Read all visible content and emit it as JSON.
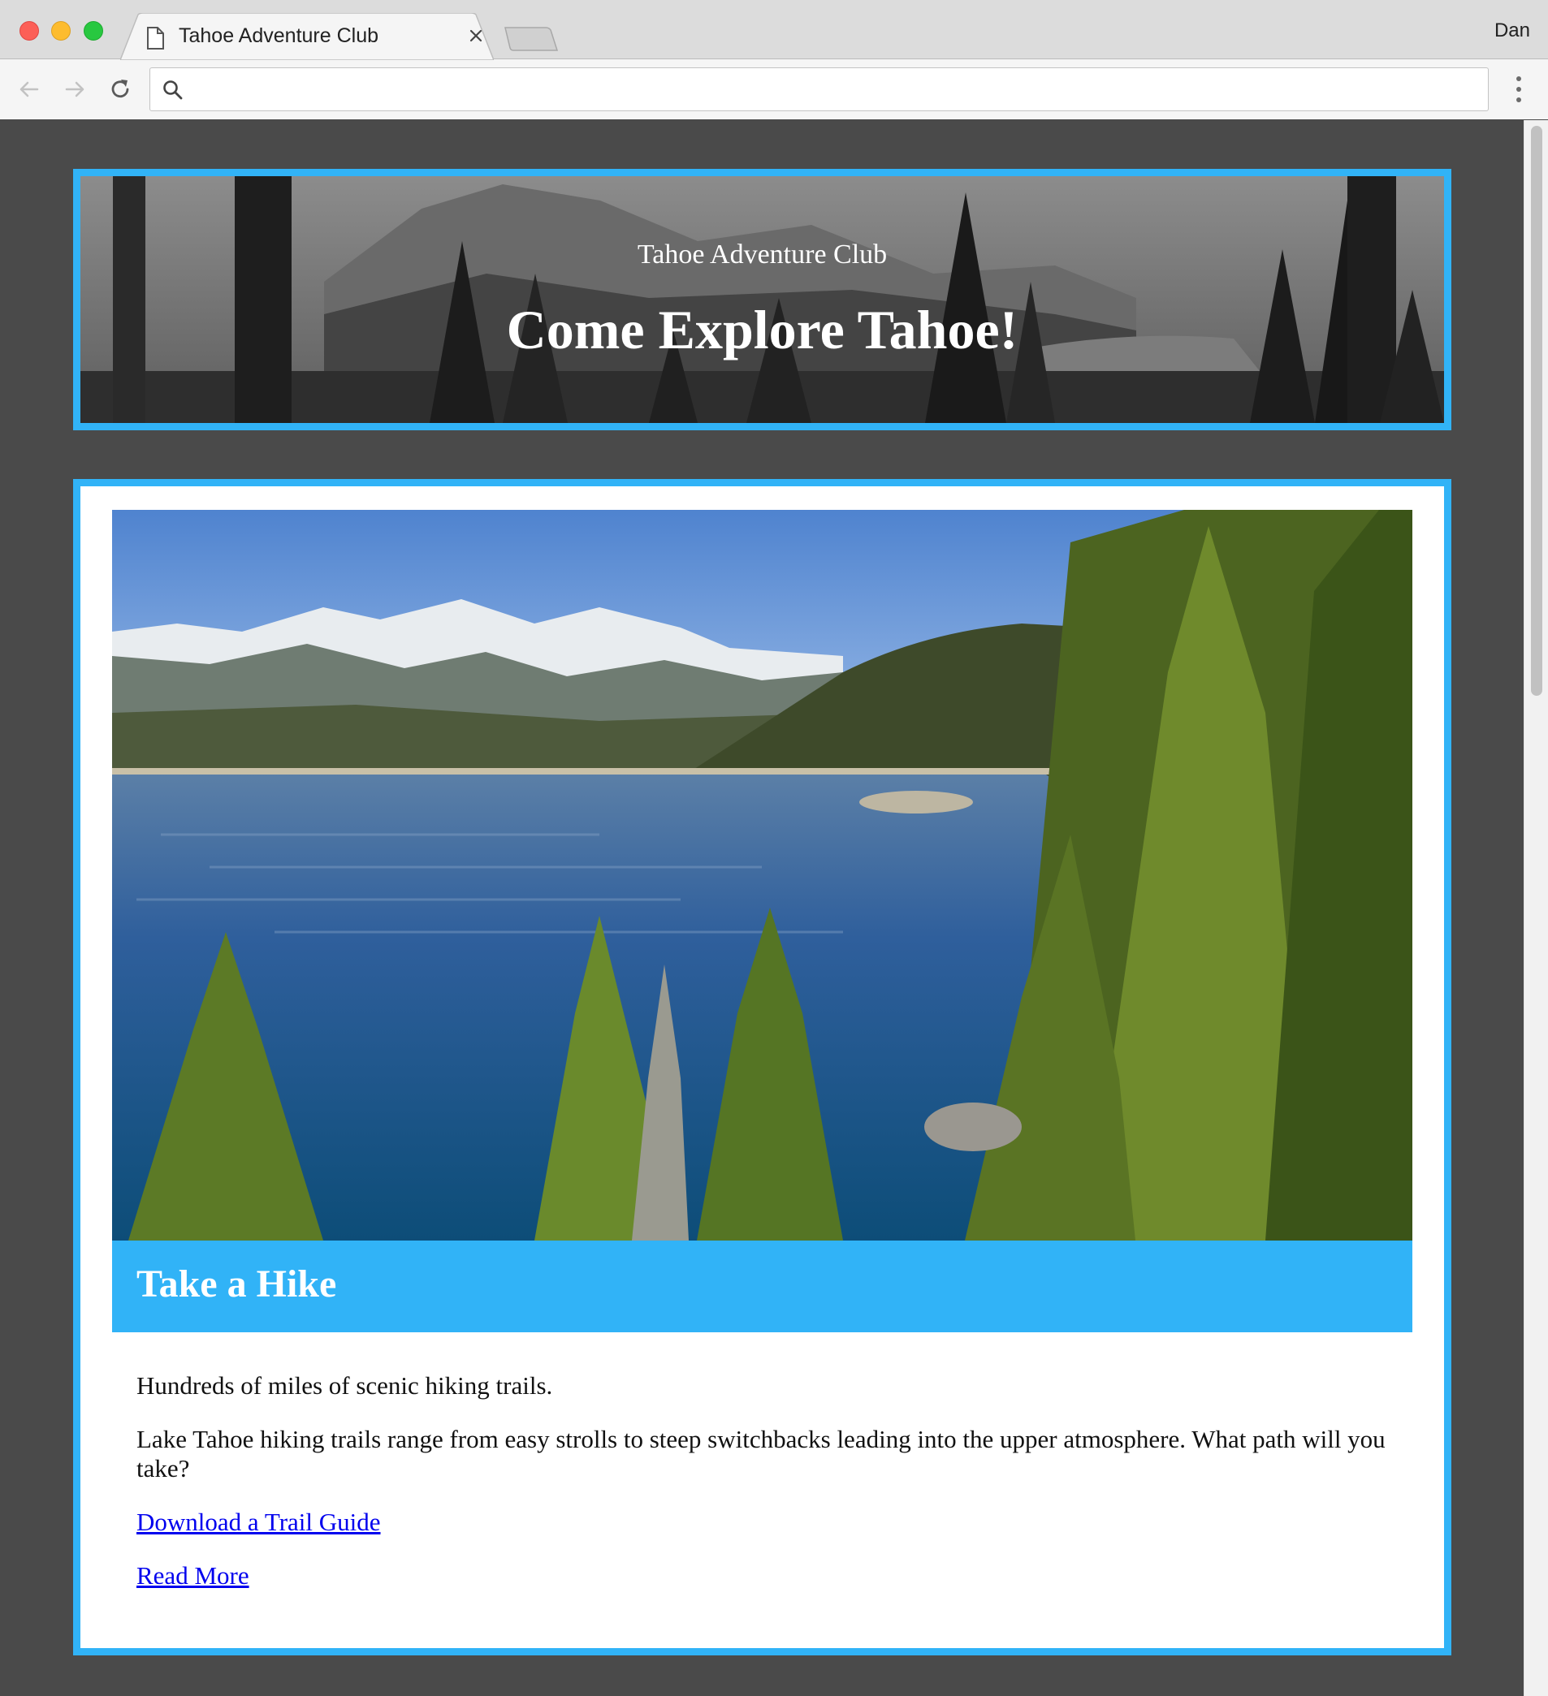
{
  "browser": {
    "tab_title": "Tahoe Adventure Club",
    "profile_name": "Dan",
    "address_value": "",
    "icons": [
      "page-icon",
      "close-icon",
      "back-arrow-icon",
      "forward-arrow-icon",
      "reload-icon",
      "search-icon",
      "more-menu-icon"
    ]
  },
  "banner": {
    "subtitle": "Tahoe Adventure Club",
    "title": "Come Explore Tahoe!"
  },
  "card": {
    "heading": "Take a Hike",
    "lead": "Hundreds of miles of scenic hiking trails.",
    "description": "Lake Tahoe hiking trails range from easy strolls to steep switchbacks leading into the upper atmosphere. What path will you take?",
    "link_download": "Download a Trail Guide",
    "link_read_more": "Read More"
  },
  "colors": {
    "accent": "#31b3f7",
    "page_background": "#4a4a4a",
    "link": "#0000ee"
  }
}
